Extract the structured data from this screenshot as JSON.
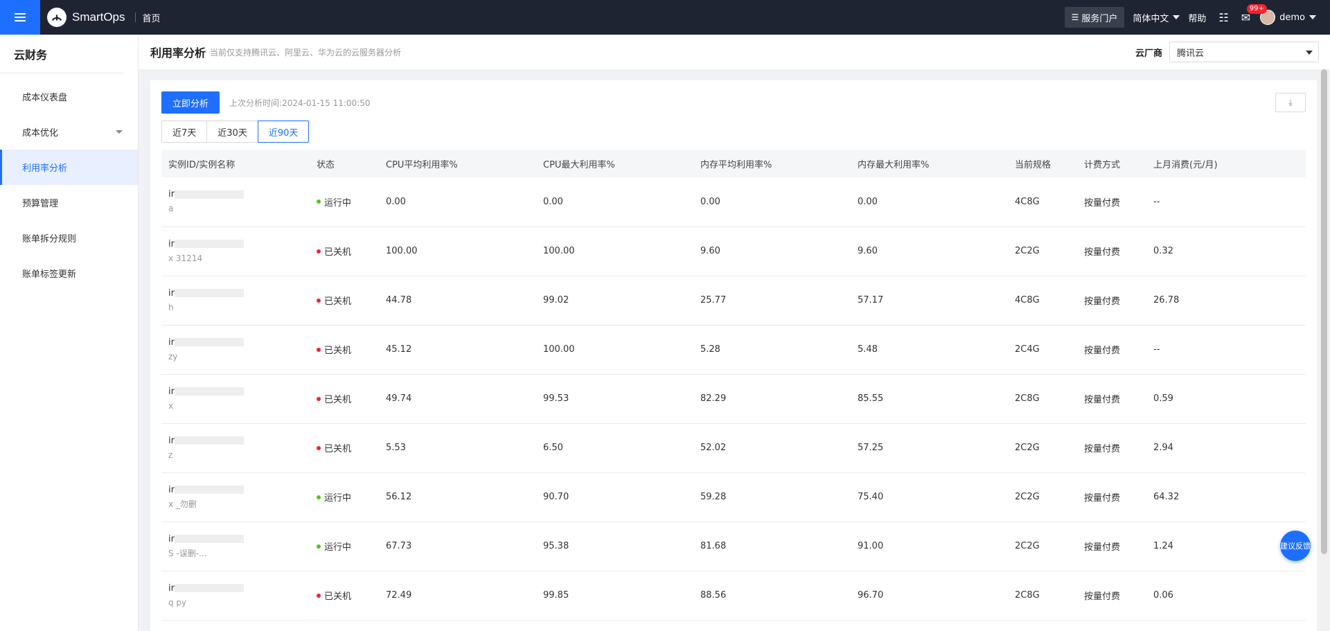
{
  "header": {
    "brand": "SmartOps",
    "home": "首页",
    "service_portal": "服务门户",
    "language": "简体中文",
    "help": "帮助",
    "notification_count": "99+",
    "user": "demo"
  },
  "sidebar": {
    "title": "云财务",
    "items": [
      {
        "label": "成本仪表盘"
      },
      {
        "label": "成本优化"
      },
      {
        "label": "利用率分析"
      },
      {
        "label": "预算管理"
      },
      {
        "label": "账单拆分规则"
      },
      {
        "label": "账单标签更新"
      }
    ]
  },
  "page": {
    "title": "利用率分析",
    "subtitle": "当前仅支持腾讯云、阿里云、华为云的云服务器分析",
    "vendor_label": "云厂商",
    "vendor_value": "腾讯云"
  },
  "toolbar": {
    "analyze_label": "立即分析",
    "last_time": "上次分析时间:2024-01-15 11:00:50",
    "ranges": [
      "近7天",
      "近30天",
      "近90天"
    ]
  },
  "table": {
    "columns": [
      "实例ID/实例名称",
      "状态",
      "CPU平均利用率%",
      "CPU最大利用率%",
      "内存平均利用率%",
      "内存最大利用率%",
      "当前规格",
      "计费方式",
      "上月消费(元/月)"
    ],
    "rows": [
      {
        "id": "ir",
        "name": "a",
        "status": "运行中",
        "cpu_avg": "0.00",
        "cpu_max": "0.00",
        "mem_avg": "0.00",
        "mem_max": "0.00",
        "spec": "4C8G",
        "billing": "按量付费",
        "cost": "--"
      },
      {
        "id": "ir",
        "name": "x 31214",
        "status": "已关机",
        "cpu_avg": "100.00",
        "cpu_max": "100.00",
        "mem_avg": "9.60",
        "mem_max": "9.60",
        "spec": "2C2G",
        "billing": "按量付费",
        "cost": "0.32"
      },
      {
        "id": "ir",
        "name": "h",
        "status": "已关机",
        "cpu_avg": "44.78",
        "cpu_max": "99.02",
        "mem_avg": "25.77",
        "mem_max": "57.17",
        "spec": "4C8G",
        "billing": "按量付费",
        "cost": "26.78"
      },
      {
        "id": "ir",
        "name": "zy",
        "status": "已关机",
        "cpu_avg": "45.12",
        "cpu_max": "100.00",
        "mem_avg": "5.28",
        "mem_max": "5.48",
        "spec": "2C4G",
        "billing": "按量付费",
        "cost": "--"
      },
      {
        "id": "ir",
        "name": "x",
        "status": "已关机",
        "cpu_avg": "49.74",
        "cpu_max": "99.53",
        "mem_avg": "82.29",
        "mem_max": "85.55",
        "spec": "2C8G",
        "billing": "按量付费",
        "cost": "0.59"
      },
      {
        "id": "ir",
        "name": "z",
        "status": "已关机",
        "cpu_avg": "5.53",
        "cpu_max": "6.50",
        "mem_avg": "52.02",
        "mem_max": "57.25",
        "spec": "2C2G",
        "billing": "按量付费",
        "cost": "2.94"
      },
      {
        "id": "ir",
        "name": "x _勿删",
        "status": "运行中",
        "cpu_avg": "56.12",
        "cpu_max": "90.70",
        "mem_avg": "59.28",
        "mem_max": "75.40",
        "spec": "2C2G",
        "billing": "按量付费",
        "cost": "64.32"
      },
      {
        "id": "ir",
        "name": "S -误删-...",
        "status": "运行中",
        "cpu_avg": "67.73",
        "cpu_max": "95.38",
        "mem_avg": "81.68",
        "mem_max": "91.00",
        "spec": "2C2G",
        "billing": "按量付费",
        "cost": "1.24"
      },
      {
        "id": "ir",
        "name": "q py",
        "status": "已关机",
        "cpu_avg": "72.49",
        "cpu_max": "99.85",
        "mem_avg": "88.56",
        "mem_max": "96.70",
        "spec": "2C8G",
        "billing": "按量付费",
        "cost": "0.06"
      }
    ]
  },
  "feedback": "建议反馈",
  "colors": {
    "accent": "#1e6fff",
    "header_bg": "#1f2433",
    "running": "#52c41a",
    "stopped": "#f5222d"
  }
}
